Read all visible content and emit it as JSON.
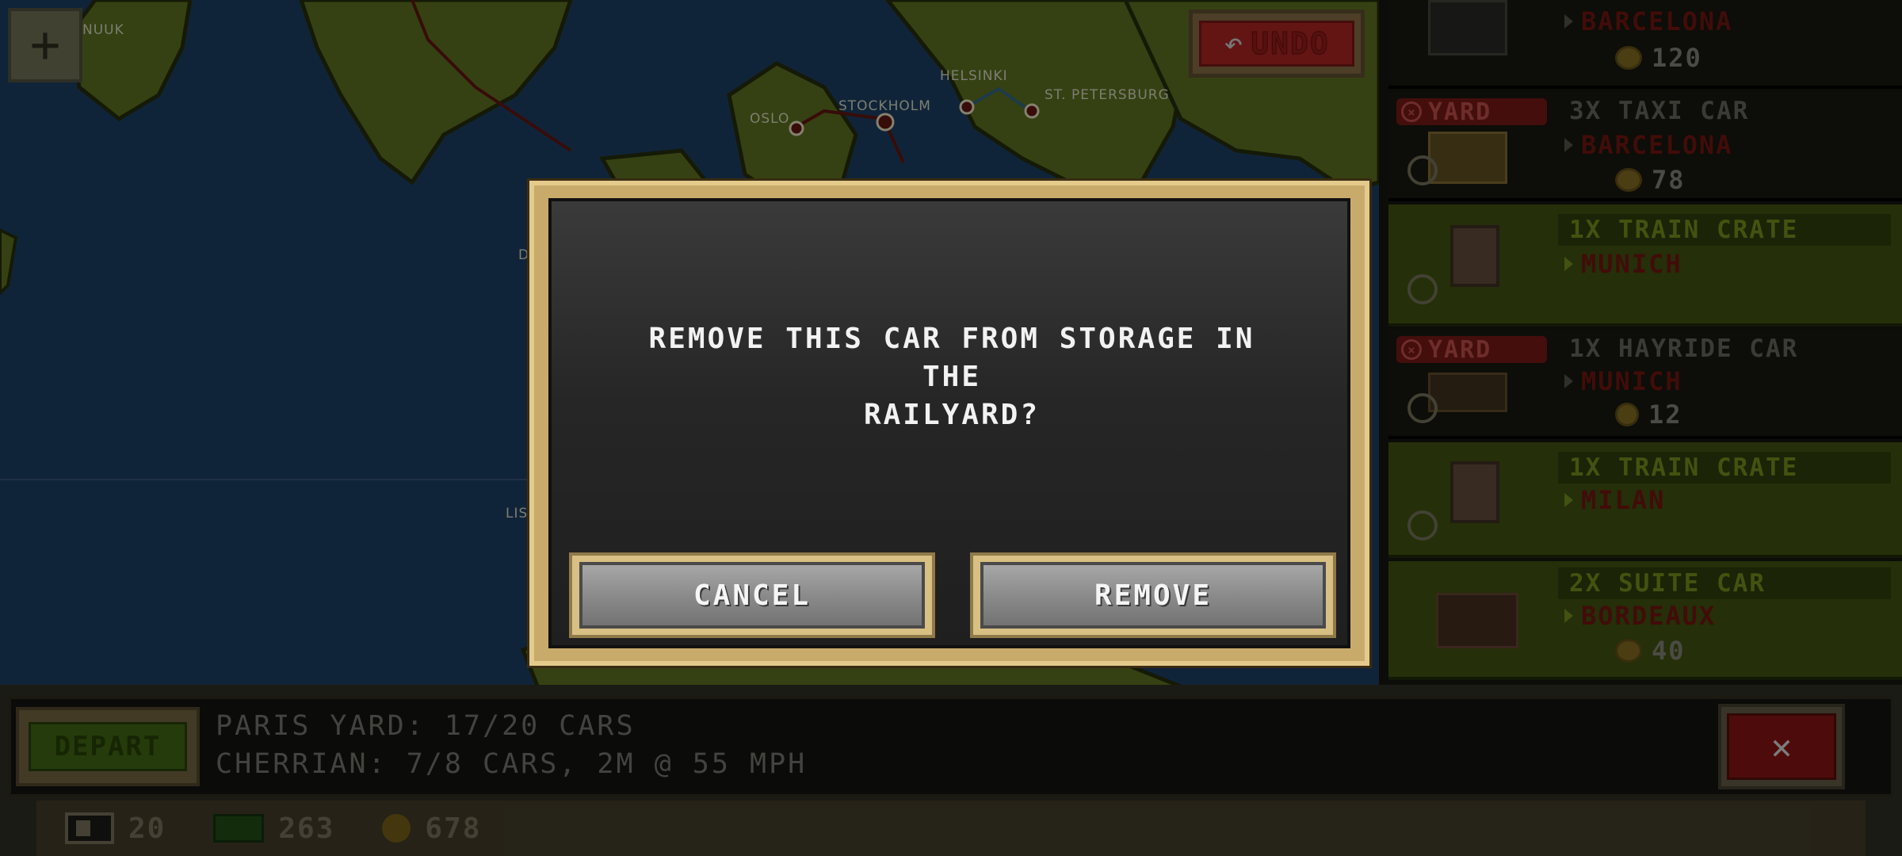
{
  "map": {
    "cities": [
      "NUUK",
      "HELSINKI",
      "OSLO",
      "STOCKHOLM",
      "ST. PETERSBURG",
      "D",
      "LIS"
    ]
  },
  "toolbar": {
    "zoom_symbol": "+",
    "undo_label": "UNDO",
    "undo_arrow": "↶"
  },
  "cars": [
    {
      "badge": "",
      "name": "",
      "dest": "BARCELONA",
      "pay": "120",
      "style": "dark"
    },
    {
      "badge": "YARD",
      "name": "3X TAXI CAR",
      "dest": "BARCELONA",
      "pay": "78",
      "style": "dark"
    },
    {
      "badge": "",
      "name": "1X TRAIN CRATE",
      "dest": "MUNICH",
      "pay": "",
      "style": "green"
    },
    {
      "badge": "YARD",
      "name": "1X HAYRIDE CAR",
      "dest": "MUNICH",
      "pay": "12",
      "style": "dark"
    },
    {
      "badge": "",
      "name": "1X TRAIN CRATE",
      "dest": "MILAN",
      "pay": "",
      "style": "green"
    },
    {
      "badge": "",
      "name": "2X SUITE CAR",
      "dest": "BORDEAUX",
      "pay": "40",
      "style": "green"
    }
  ],
  "bottom": {
    "depart_label": "DEPART",
    "yard_status": "PARIS YARD: 17/20 CARS",
    "train_status": "CHERRIAN: 7/8 CARS, 2M @ 55 MPH",
    "close_symbol": "✕",
    "resources": {
      "cars": "20",
      "cash": "263",
      "gold": "678"
    }
  },
  "dialog": {
    "message": "REMOVE THIS CAR FROM STORAGE IN THE\nRAILYARD?",
    "cancel_label": "CANCEL",
    "remove_label": "REMOVE"
  },
  "colors": {
    "ocean": "#10263e",
    "land": "#4a5c1c",
    "dialog_gold": "#e4cb8c",
    "destination_red": "#6a1410"
  }
}
